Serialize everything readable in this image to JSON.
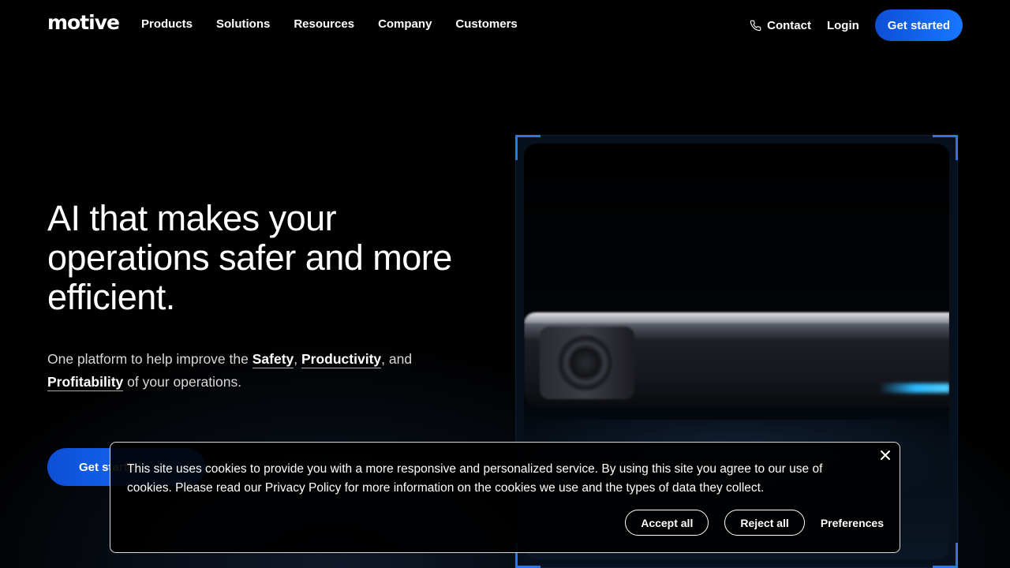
{
  "header": {
    "logo": "motive",
    "nav": [
      "Products",
      "Solutions",
      "Resources",
      "Company",
      "Customers"
    ],
    "contact_label": "Contact",
    "login_label": "Login",
    "cta_label": "Get started"
  },
  "hero": {
    "title": "AI that makes your operations safer and more efficient.",
    "subtitle_prefix": "One platform to help improve the",
    "links": [
      "Safety",
      "Productivity",
      "Profitability"
    ],
    "subtitle_and": ", and",
    "subtitle_suffix": "of your operations.",
    "cta_label": "Get started"
  },
  "cookie_banner": {
    "text": "This site uses cookies to provide you with a more responsive and personalized service. By using this site you agree to our use of cookies. Please read our Privacy Policy for more information on the cookies we use and the types of data they collect.",
    "accept_label": "Accept all",
    "reject_label": "Reject all",
    "preferences_label": "Preferences"
  },
  "colors": {
    "accent": "#1877ff",
    "frame_corner": "#2b78e4",
    "background": "#000000"
  }
}
